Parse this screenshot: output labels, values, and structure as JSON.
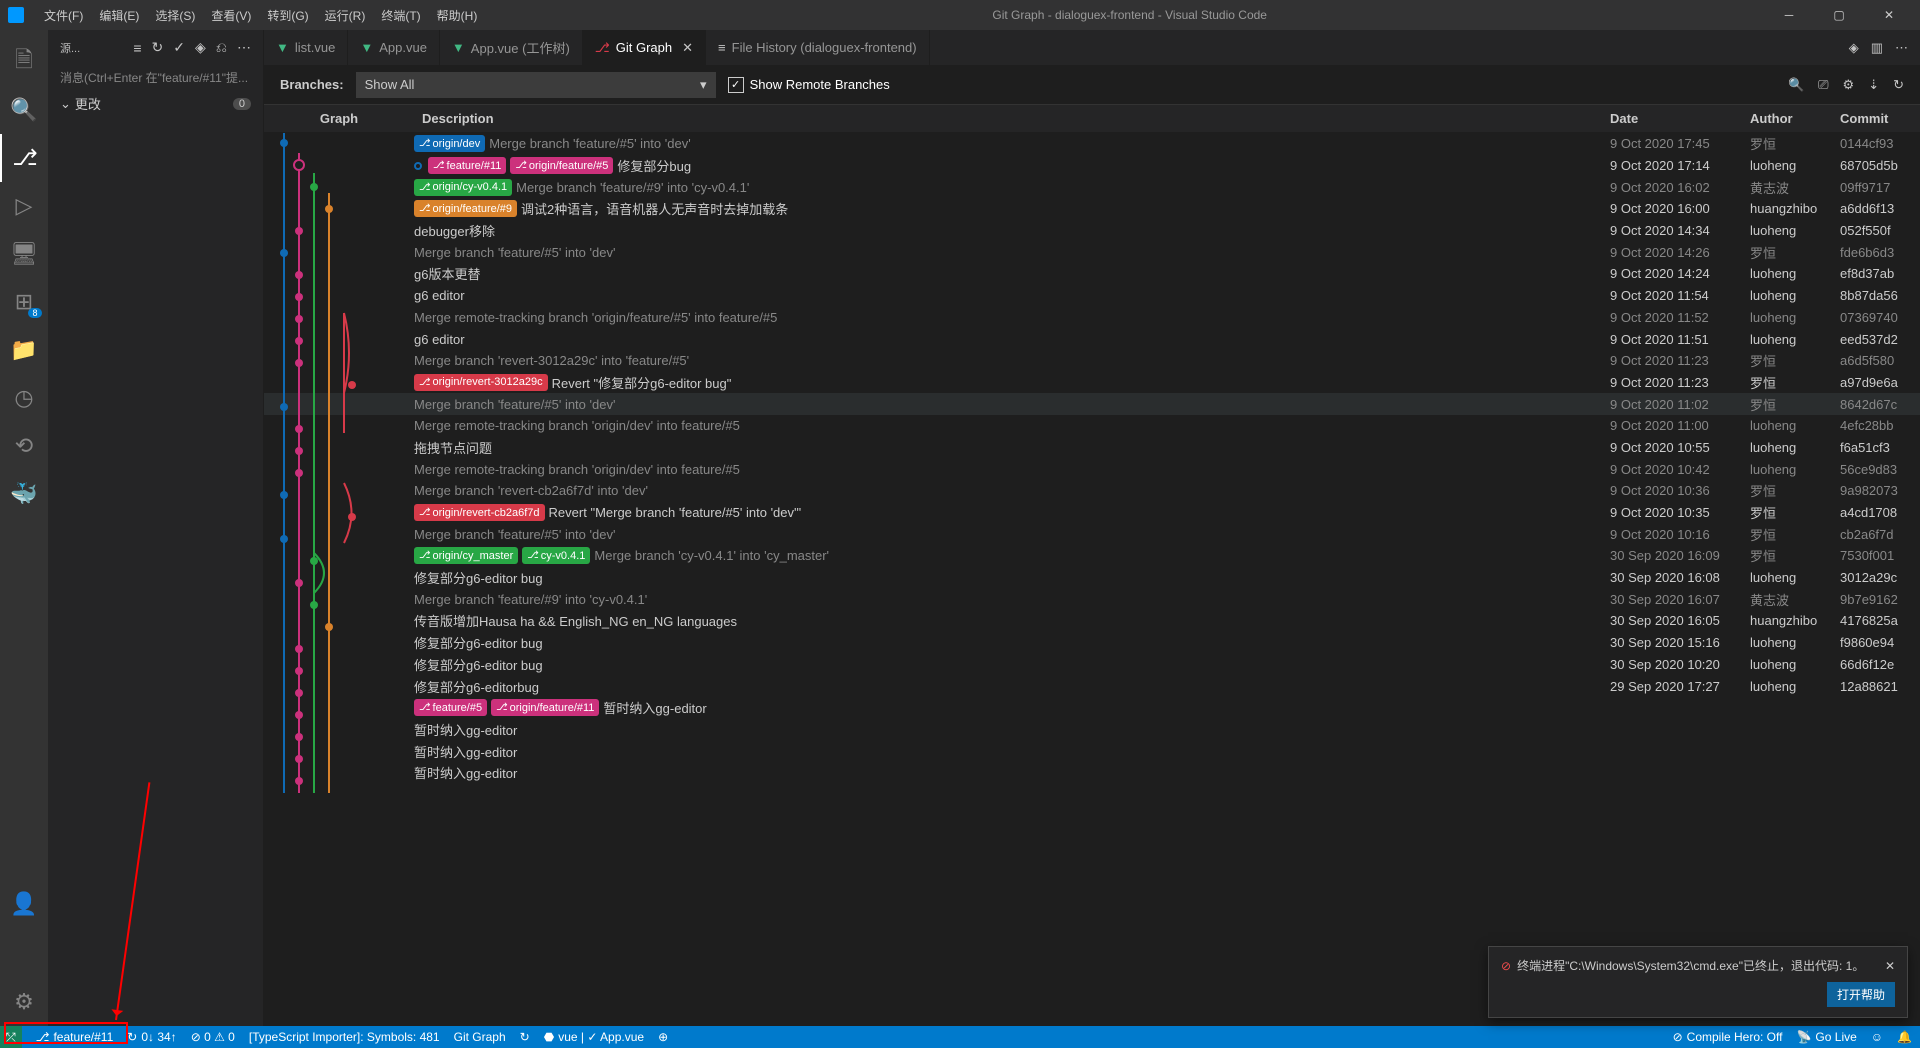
{
  "window": {
    "title": "Git Graph - dialoguex-frontend - Visual Studio Code"
  },
  "menu": [
    "文件(F)",
    "编辑(E)",
    "选择(S)",
    "查看(V)",
    "转到(G)",
    "运行(R)",
    "终端(T)",
    "帮助(H)"
  ],
  "sidebar": {
    "source_label": "源...",
    "message_hint": "消息(Ctrl+Enter 在\"feature/#11\"提...",
    "changes_label": "更改",
    "changes_count": "0",
    "extensions_badge": "8"
  },
  "tabs": [
    {
      "label": "list.vue",
      "icon": "vue",
      "active": false
    },
    {
      "label": "App.vue",
      "icon": "vue",
      "active": false
    },
    {
      "label": "App.vue (工作树)",
      "icon": "vue",
      "active": false
    },
    {
      "label": "Git Graph",
      "icon": "gitgraph",
      "active": true,
      "closable": true
    },
    {
      "label": "File History (dialoguex-frontend)",
      "icon": "history",
      "active": false
    }
  ],
  "gitgraph": {
    "branches_label": "Branches:",
    "branches_value": "Show All",
    "show_remote": "Show Remote Branches",
    "columns": {
      "graph": "Graph",
      "desc": "Description",
      "date": "Date",
      "author": "Author",
      "commit": "Commit"
    }
  },
  "commits": [
    {
      "refs": [
        {
          "text": "origin/dev",
          "cls": "blue"
        }
      ],
      "desc": "Merge branch 'feature/#5' into 'dev'",
      "date": "9 Oct 2020 17:45",
      "author": "罗恒",
      "commit": "0144cf93",
      "dim": true
    },
    {
      "head": true,
      "refs": [
        {
          "text": "feature/#11",
          "cls": "pink"
        },
        {
          "text": "origin/feature/#5",
          "cls": "pink"
        }
      ],
      "desc": "修复部分bug",
      "date": "9 Oct 2020 17:14",
      "author": "luoheng",
      "commit": "68705d5b"
    },
    {
      "refs": [
        {
          "text": "origin/cy-v0.4.1",
          "cls": "green"
        }
      ],
      "desc": "Merge branch 'feature/#9' into 'cy-v0.4.1'",
      "date": "9 Oct 2020 16:02",
      "author": "黄志波",
      "commit": "09ff9717",
      "dim": true
    },
    {
      "refs": [
        {
          "text": "origin/feature/#9",
          "cls": "orange"
        }
      ],
      "desc": "调试2种语言，语音机器人无声音时去掉加载条",
      "date": "9 Oct 2020 16:00",
      "author": "huangzhibo",
      "commit": "a6dd6f13"
    },
    {
      "desc": "debugger移除",
      "date": "9 Oct 2020 14:34",
      "author": "luoheng",
      "commit": "052f550f"
    },
    {
      "desc": "Merge branch 'feature/#5' into 'dev'",
      "date": "9 Oct 2020 14:26",
      "author": "罗恒",
      "commit": "fde6b6d3",
      "dim": true
    },
    {
      "desc": "g6版本更替",
      "date": "9 Oct 2020 14:24",
      "author": "luoheng",
      "commit": "ef8d37ab"
    },
    {
      "desc": "g6 editor",
      "date": "9 Oct 2020 11:54",
      "author": "luoheng",
      "commit": "8b87da56"
    },
    {
      "desc": "Merge remote-tracking branch 'origin/feature/#5' into feature/#5",
      "date": "9 Oct 2020 11:52",
      "author": "luoheng",
      "commit": "07369740",
      "dim": true
    },
    {
      "desc": "g6 editor",
      "date": "9 Oct 2020 11:51",
      "author": "luoheng",
      "commit": "eed537d2"
    },
    {
      "desc": "Merge branch 'revert-3012a29c' into 'feature/#5'",
      "date": "9 Oct 2020 11:23",
      "author": "罗恒",
      "commit": "a6d5f580",
      "dim": true
    },
    {
      "refs": [
        {
          "text": "origin/revert-3012a29c",
          "cls": "red"
        }
      ],
      "desc": "Revert \"修复部分g6-editor bug\"",
      "date": "9 Oct 2020 11:23",
      "author": "罗恒",
      "commit": "a97d9e6a"
    },
    {
      "desc": "Merge branch 'feature/#5' into 'dev'",
      "date": "9 Oct 2020 11:02",
      "author": "罗恒",
      "commit": "8642d67c",
      "dim": true,
      "selected": true
    },
    {
      "desc": "Merge remote-tracking branch 'origin/dev' into feature/#5",
      "date": "9 Oct 2020 11:00",
      "author": "luoheng",
      "commit": "4efc28bb",
      "dim": true
    },
    {
      "desc": "拖拽节点问题",
      "date": "9 Oct 2020 10:55",
      "author": "luoheng",
      "commit": "f6a51cf3"
    },
    {
      "desc": "Merge remote-tracking branch 'origin/dev' into feature/#5",
      "date": "9 Oct 2020 10:42",
      "author": "luoheng",
      "commit": "56ce9d83",
      "dim": true
    },
    {
      "desc": "Merge branch 'revert-cb2a6f7d' into 'dev'",
      "date": "9 Oct 2020 10:36",
      "author": "罗恒",
      "commit": "9a982073",
      "dim": true
    },
    {
      "refs": [
        {
          "text": "origin/revert-cb2a6f7d",
          "cls": "red"
        }
      ],
      "desc": "Revert \"Merge branch 'feature/#5' into 'dev'\"",
      "date": "9 Oct 2020 10:35",
      "author": "罗恒",
      "commit": "a4cd1708"
    },
    {
      "desc": "Merge branch 'feature/#5' into 'dev'",
      "date": "9 Oct 2020 10:16",
      "author": "罗恒",
      "commit": "cb2a6f7d",
      "dim": true
    },
    {
      "refs": [
        {
          "text": "origin/cy_master",
          "cls": "green"
        },
        {
          "text": "cy-v0.4.1",
          "cls": "green"
        }
      ],
      "desc": "Merge branch 'cy-v0.4.1' into 'cy_master'",
      "date": "30 Sep 2020 16:09",
      "author": "罗恒",
      "commit": "7530f001",
      "dim": true
    },
    {
      "desc": "修复部分g6-editor bug",
      "date": "30 Sep 2020 16:08",
      "author": "luoheng",
      "commit": "3012a29c"
    },
    {
      "desc": "Merge branch 'feature/#9' into 'cy-v0.4.1'",
      "date": "30 Sep 2020 16:07",
      "author": "黄志波",
      "commit": "9b7e9162",
      "dim": true
    },
    {
      "desc": "传音版增加Hausa ha && English_NG en_NG languages",
      "date": "30 Sep 2020 16:05",
      "author": "huangzhibo",
      "commit": "4176825a"
    },
    {
      "desc": "修复部分g6-editor bug",
      "date": "30 Sep 2020 15:16",
      "author": "luoheng",
      "commit": "f9860e94"
    },
    {
      "desc": "修复部分g6-editor bug",
      "date": "30 Sep 2020 10:20",
      "author": "luoheng",
      "commit": "66d6f12e"
    },
    {
      "desc": "修复部分g6-editorbug",
      "date": "29 Sep 2020 17:27",
      "author": "luoheng",
      "commit": "12a88621"
    },
    {
      "refs": [
        {
          "text": "feature/#5",
          "cls": "pink"
        },
        {
          "text": "origin/feature/#11",
          "cls": "pink"
        }
      ],
      "desc": "暂时纳入gg-editor",
      "date": "",
      "author": "",
      "commit": ""
    },
    {
      "desc": "暂时纳入gg-editor",
      "date": "",
      "author": "",
      "commit": ""
    },
    {
      "desc": "暂时纳入gg-editor",
      "date": "",
      "author": "",
      "commit": ""
    },
    {
      "desc": "暂时纳入gg-editor",
      "date": "",
      "author": "",
      "commit": ""
    }
  ],
  "notification": {
    "text": "终端进程\"C:\\Windows\\System32\\cmd.exe\"已终止，退出代码: 1。",
    "button": "打开帮助"
  },
  "statusbar": {
    "branch": "feature/#11",
    "sync": "0↓ 34↑",
    "problems": "⊘ 0 ⚠ 0",
    "ts_importer": "[TypeScript Importer]: Symbols: 481",
    "gitgraph": "Git Graph",
    "vue": "vue | ✓ App.vue",
    "compile_hero": "Compile Hero: Off",
    "golive": "Go Live",
    "bell": "🔔"
  }
}
